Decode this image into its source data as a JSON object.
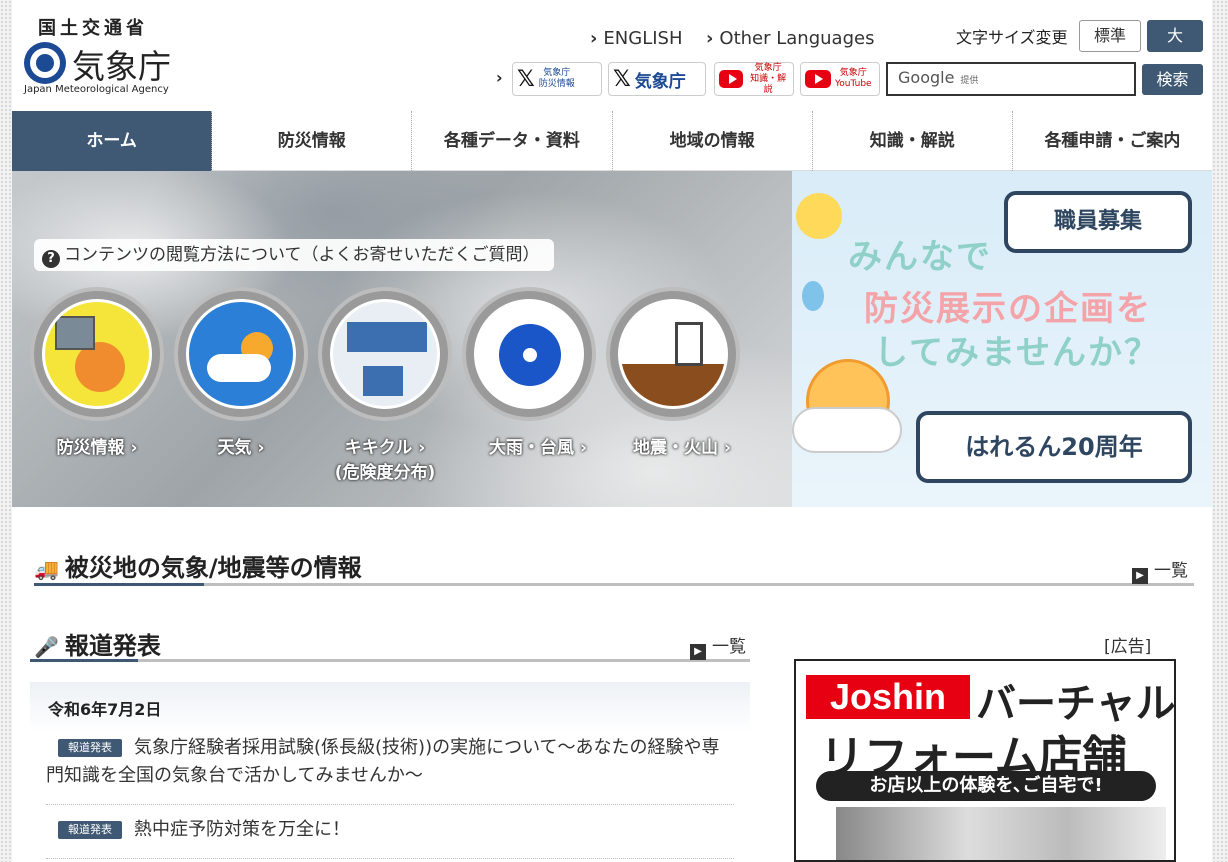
{
  "header": {
    "logo_top": "国土交通省",
    "logo_main": "気象庁",
    "logo_sub": "Japan Meteorological Agency",
    "lang_english": "ENGLISH",
    "lang_other": "Other Languages",
    "fontsize_label": "文字サイズ変更",
    "fontsize_normal": "標準",
    "fontsize_large": "大",
    "sns": [
      {
        "label": "気象庁\n防災情報",
        "kind": "x-icon"
      },
      {
        "label": "気象庁",
        "kind": "x-icon"
      },
      {
        "label": "気象庁\n知識・解説",
        "kind": "youtube-icon"
      },
      {
        "label": "気象庁\nYouTube",
        "kind": "youtube-icon"
      }
    ],
    "search_provider": "Google",
    "search_provider_suffix": "提供",
    "search_button": "検索"
  },
  "nav": [
    "ホーム",
    "防災情報",
    "各種データ・資料",
    "地域の情報",
    "知識・解説",
    "各種申請・ご案内"
  ],
  "hero": {
    "question": "コンテンツの閲覧方法について（よくお寄せいただくご質問）",
    "circles": [
      {
        "label": "防災情報 ›",
        "color": "#f5e53a"
      },
      {
        "label": "天気 ›",
        "color": "#2c7fd6"
      },
      {
        "label": "キキクル ›",
        "sub": "(危険度分布)",
        "color": "#e8eef3"
      },
      {
        "label": "大雨・台風 ›",
        "color": "#ffffff"
      },
      {
        "label": "地震・火山 ›",
        "color": "#ffffff"
      }
    ]
  },
  "banner": {
    "recruit": "職員募集",
    "slogan_line1": "みんなで",
    "slogan_line2": "防災展示の企画を",
    "slogan_line3": "してみませんか？",
    "anniversary": "はれるん20周年"
  },
  "disaster_section": {
    "title": "被災地の気象/地震等の情報",
    "more": "一覧"
  },
  "press_section": {
    "title": "報道発表",
    "more": "一覧",
    "date": "令和6年7月2日",
    "items": [
      {
        "badge": "報道発表",
        "text": "気象庁経験者採用試験(係長級(技術))の実施について～あなたの経験や専門知識を全国の気象台で活かしてみませんか～"
      },
      {
        "badge": "報道発表",
        "text": "熱中症予防対策を万全に！"
      }
    ]
  },
  "ad": {
    "label": "[広告]",
    "brand": "Joshin",
    "line1": "バーチャル",
    "line2": "リフォーム店舗",
    "line3": "お店以上の体験を､ご自宅で!"
  }
}
